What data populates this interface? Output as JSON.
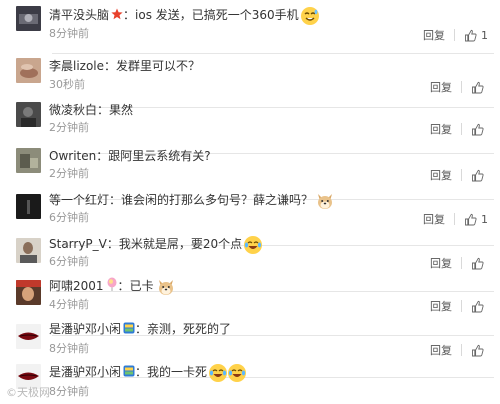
{
  "comments": [
    {
      "user": "清平没头脑",
      "text": "ios 发送，已搞死一个360手机",
      "time": "8分钟前",
      "reply": "回复",
      "likes": "1",
      "avatar_color": "#3c3c46",
      "badge": "star-badge",
      "emoji": "sweat-smile-emoji"
    },
    {
      "user": "李晨lizole",
      "text": "发群里可以不？",
      "time": "30秒前",
      "reply": "回复",
      "likes": "",
      "avatar_color": "#c9a68e"
    },
    {
      "user": "微凌秋白",
      "text": "果然",
      "time": "2分钟前",
      "reply": "回复",
      "likes": "",
      "avatar_color": "#4a4a4a"
    },
    {
      "user": "Owriten",
      "text": "跟阿里云系统有关?",
      "time": "2分钟前",
      "reply": "回复",
      "likes": "",
      "avatar_color": "#8c8c7a"
    },
    {
      "user": "等一个红灯",
      "text": "谁会闲的打那么多句号？薛之谦吗？",
      "time": "6分钟前",
      "reply": "回复",
      "likes": "1",
      "avatar_color": "#1a1a1a",
      "emoji": "doge-emoji"
    },
    {
      "user": "StarryP_V",
      "text": "我米就是屌，要20个点",
      "time": "6分钟前",
      "reply": "回复",
      "likes": "",
      "avatar_color": "#d8d2c8",
      "emoji": "laugh-cry-emoji"
    },
    {
      "user": "阿啸2001",
      "text": "已卡",
      "time": "4分钟前",
      "reply": "回复",
      "likes": "",
      "avatar_color": "#5a3a2a",
      "badge": "balloon-badge",
      "emoji": "doge-emoji"
    },
    {
      "user": "是潘驴邓小闲",
      "text": "亲测，死死的了",
      "time": "8分钟前",
      "reply": "回复",
      "likes": "",
      "avatar_color": "#f2f2f2",
      "badge": "vip-badge"
    },
    {
      "user": "是潘驴邓小闲",
      "text": "我的一卡死",
      "time": "8分钟前",
      "reply": "回复",
      "likes": "",
      "avatar_color": "#f2f2f2",
      "badge": "vip-badge",
      "emoji": "laugh-cry-emoji"
    }
  ],
  "watermark": "©天极网"
}
